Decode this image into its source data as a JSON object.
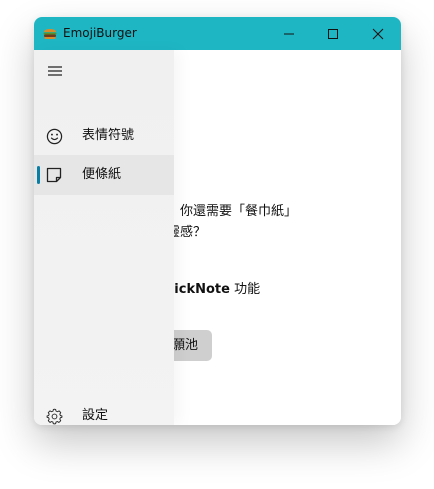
{
  "window": {
    "title": "EmojiBurger",
    "accent_color": "#1fb6c4"
  },
  "titlebar_buttons": {
    "minimize_icon": "minimize-icon",
    "maximize_icon": "maximize-icon",
    "close_icon": "close-icon"
  },
  "nav": {
    "menu_icon": "hamburger-icon",
    "items": [
      {
        "label": "表情符號",
        "icon": "emoji-icon"
      },
      {
        "label": "便條紙",
        "icon": "note-icon",
        "selected": true
      }
    ],
    "settings": {
      "label": "設定",
      "icon": "gear-icon"
    }
  },
  "main": {
    "line1": "悉，你還需要「餐巾紙」",
    "line2": "錄靈感？",
    "feature_bold": "QuickNote",
    "feature_rest": " 功能",
    "button_label": "願池"
  }
}
